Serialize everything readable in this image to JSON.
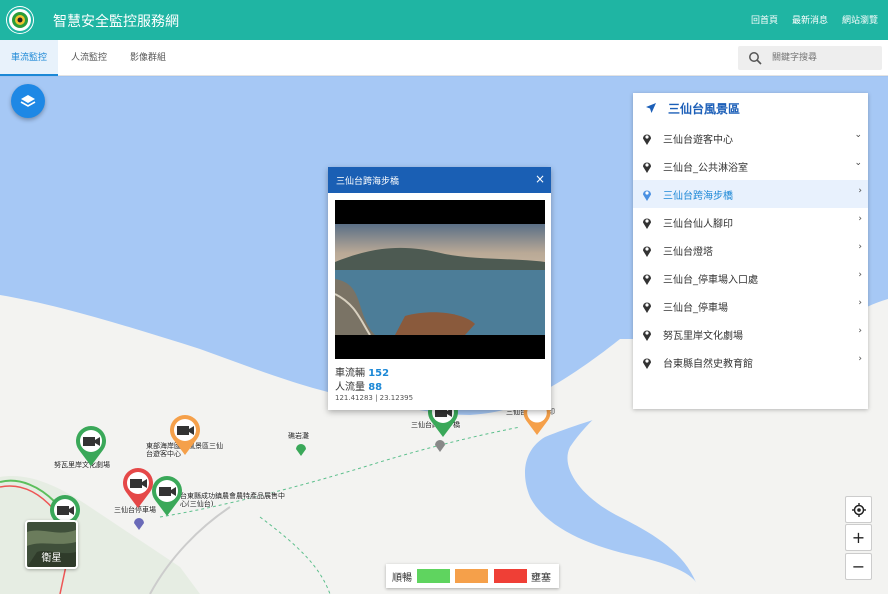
{
  "app": {
    "title": "智慧安全監控服務網"
  },
  "top_links": [
    "回首頁",
    "最新消息",
    "網站瀏覽"
  ],
  "tabs": [
    {
      "label": "車流監控",
      "active": true
    },
    {
      "label": "人流監控",
      "active": false
    },
    {
      "label": "影像群組",
      "active": false
    }
  ],
  "search": {
    "placeholder": "關鍵字搜尋"
  },
  "popup": {
    "title": "三仙台跨海步橋",
    "close": "×",
    "vehicles_label": "車流輛",
    "vehicles_value": "152",
    "people_label": "人流量",
    "people_value": "88",
    "coords": "121.41283 | 23.12395"
  },
  "panel": {
    "title": "三仙台風景區",
    "items": [
      {
        "label": "三仙台遊客中心",
        "chevron": "⌄"
      },
      {
        "label": "三仙台_公共淋浴室",
        "chevron": "⌄"
      },
      {
        "label": "三仙台跨海步橋",
        "chevron": "›",
        "active": true
      },
      {
        "label": "三仙台仙人腳印",
        "chevron": "›"
      },
      {
        "label": "三仙台燈塔",
        "chevron": "›"
      },
      {
        "label": "三仙台_停車場入口處",
        "chevron": "›"
      },
      {
        "label": "三仙台_停車場",
        "chevron": "›"
      },
      {
        "label": "努瓦里岸文化劇場",
        "chevron": "›"
      },
      {
        "label": "台東縣自然史教育館",
        "chevron": "›"
      }
    ]
  },
  "map_labels": {
    "bridge": "三仙台跨海步橋",
    "footprint": "三仙台仙人腳印",
    "shi": "礁岩灘",
    "theatre": "努瓦里岸文化劇場",
    "east_visitor": "東部海岸國家風景區三仙台遊客中心",
    "nature": "台東縣成功鎮農會農特產品展售中心(三仙台)",
    "parking": "三仙台停車場"
  },
  "controls": {
    "locate": "◎",
    "zoom_in": "+",
    "zoom_out": "−"
  },
  "satellite": {
    "label": "衛星"
  },
  "legend": {
    "smooth": "順暢",
    "congested": "壅塞",
    "colors": {
      "green": "#5fd45f",
      "orange": "#f5a04a",
      "red": "#ef3f36"
    }
  },
  "colors": {
    "header": "#1fb5a3",
    "accent": "#1c88d6",
    "popup_header": "#1a5fb4"
  }
}
